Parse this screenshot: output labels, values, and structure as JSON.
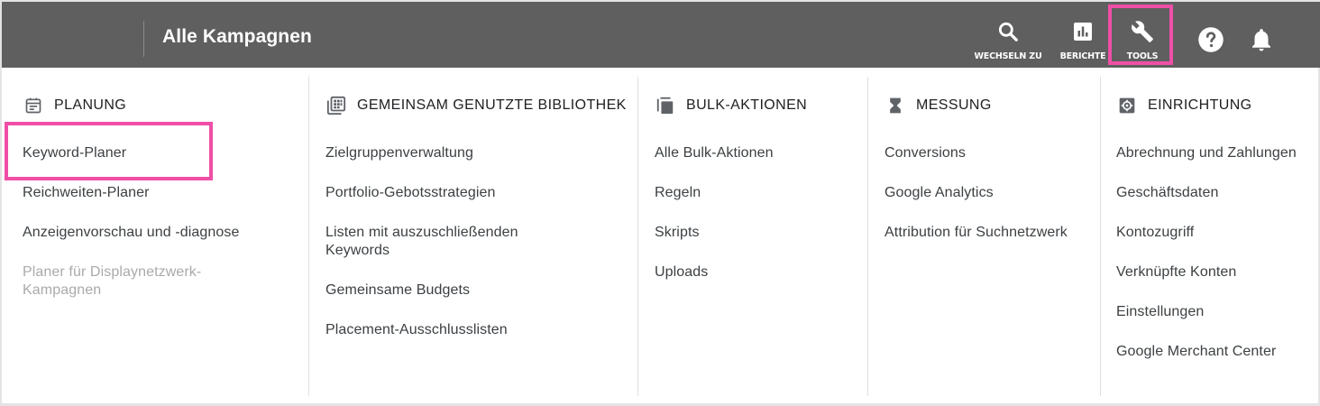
{
  "header": {
    "title": "Alle Kampagnen",
    "buttons": {
      "switch_label": "WECHSELN ZU",
      "reports_label": "BERICHTE",
      "tools_label": "TOOLS"
    },
    "icons": [
      "search-icon",
      "bar-chart-icon",
      "wrench-icon",
      "help-icon",
      "bell-icon"
    ],
    "highlight_color": "#ef4fa6",
    "bar_color": "#5f5f5f"
  },
  "menu": {
    "columns": [
      {
        "heading": "PLANUNG",
        "icon": "calendar-icon",
        "items": [
          "Keyword-Planer",
          "Reichweiten-Planer",
          "Anzeigenvorschau und -diagnose",
          "Planer für Displaynetzwerk-Kampagnen"
        ]
      },
      {
        "heading": "GEMEINSAM GENUTZTE BIBLIOTHEK",
        "icon": "library-icon",
        "items": [
          "Zielgruppenverwaltung",
          "Portfolio-Gebotsstrategien",
          "Listen mit auszuschließenden Keywords",
          "Gemeinsame Budgets",
          "Placement-Ausschlusslisten"
        ]
      },
      {
        "heading": "BULK-AKTIONEN",
        "icon": "copy-icon",
        "items": [
          "Alle Bulk-Aktionen",
          "Regeln",
          "Skripts",
          "Uploads"
        ]
      },
      {
        "heading": "MESSUNG",
        "icon": "hourglass-icon",
        "items": [
          "Conversions",
          "Google Analytics",
          "Attribution für Suchnetzwerk"
        ]
      },
      {
        "heading": "EINRICHTUNG",
        "icon": "settings-icon",
        "items": [
          "Abrechnung und Zahlungen",
          "Geschäftsdaten",
          "Kontozugriff",
          "Verknüpfte Konten",
          "Einstellungen",
          "Google Merchant Center"
        ]
      }
    ]
  }
}
